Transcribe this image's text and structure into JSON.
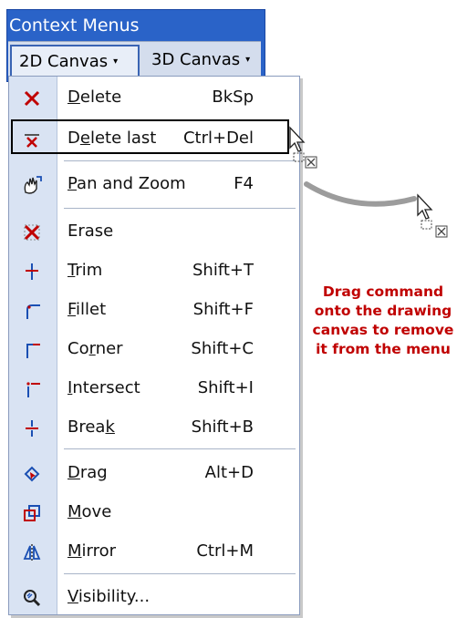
{
  "window": {
    "title": "Context Menus"
  },
  "tabs": [
    {
      "label": "2D Canvas",
      "arrow": "▾"
    },
    {
      "label": "3D Canvas",
      "arrow": "▾"
    }
  ],
  "menu": {
    "items": [
      {
        "pre": "",
        "ul": "D",
        "post": "elete",
        "shortcut": "BkSp",
        "icon": "delete-icon"
      },
      {
        "pre": "D",
        "ul": "e",
        "post": "lete last",
        "shortcut": "Ctrl+Del",
        "icon": "delete-last-icon"
      },
      {
        "pre": "",
        "ul": "P",
        "post": "an and Zoom",
        "shortcut": "F4",
        "icon": "pan-zoom-icon"
      },
      {
        "pre": "Erase",
        "ul": "",
        "post": "",
        "shortcut": "",
        "icon": "erase-icon"
      },
      {
        "pre": "",
        "ul": "T",
        "post": "rim",
        "shortcut": "Shift+T",
        "icon": "trim-icon"
      },
      {
        "pre": "",
        "ul": "F",
        "post": "illet",
        "shortcut": "Shift+F",
        "icon": "fillet-icon"
      },
      {
        "pre": "Co",
        "ul": "r",
        "post": "ner",
        "shortcut": "Shift+C",
        "icon": "corner-icon"
      },
      {
        "pre": "",
        "ul": "I",
        "post": "ntersect",
        "shortcut": "Shift+I",
        "icon": "intersect-icon"
      },
      {
        "pre": "Brea",
        "ul": "k",
        "post": "",
        "shortcut": "Shift+B",
        "icon": "break-icon"
      },
      {
        "pre": "",
        "ul": "D",
        "post": "rag",
        "shortcut": "Alt+D",
        "icon": "drag-icon"
      },
      {
        "pre": "",
        "ul": "M",
        "post": "ove",
        "shortcut": "",
        "icon": "move-icon"
      },
      {
        "pre": "",
        "ul": "M",
        "post": "irror",
        "shortcut": "Ctrl+M",
        "icon": "mirror-icon"
      },
      {
        "pre": "",
        "ul": "V",
        "post": "isibility...",
        "shortcut": "",
        "icon": "visibility-icon"
      }
    ]
  },
  "annotation": {
    "lines": [
      "Drag command",
      "onto the drawing",
      "canvas to remove",
      "it  from the menu"
    ],
    "color": "#c00000"
  },
  "colors": {
    "title_bar": "#2a63c8",
    "gutter": "#d9e3f3"
  }
}
